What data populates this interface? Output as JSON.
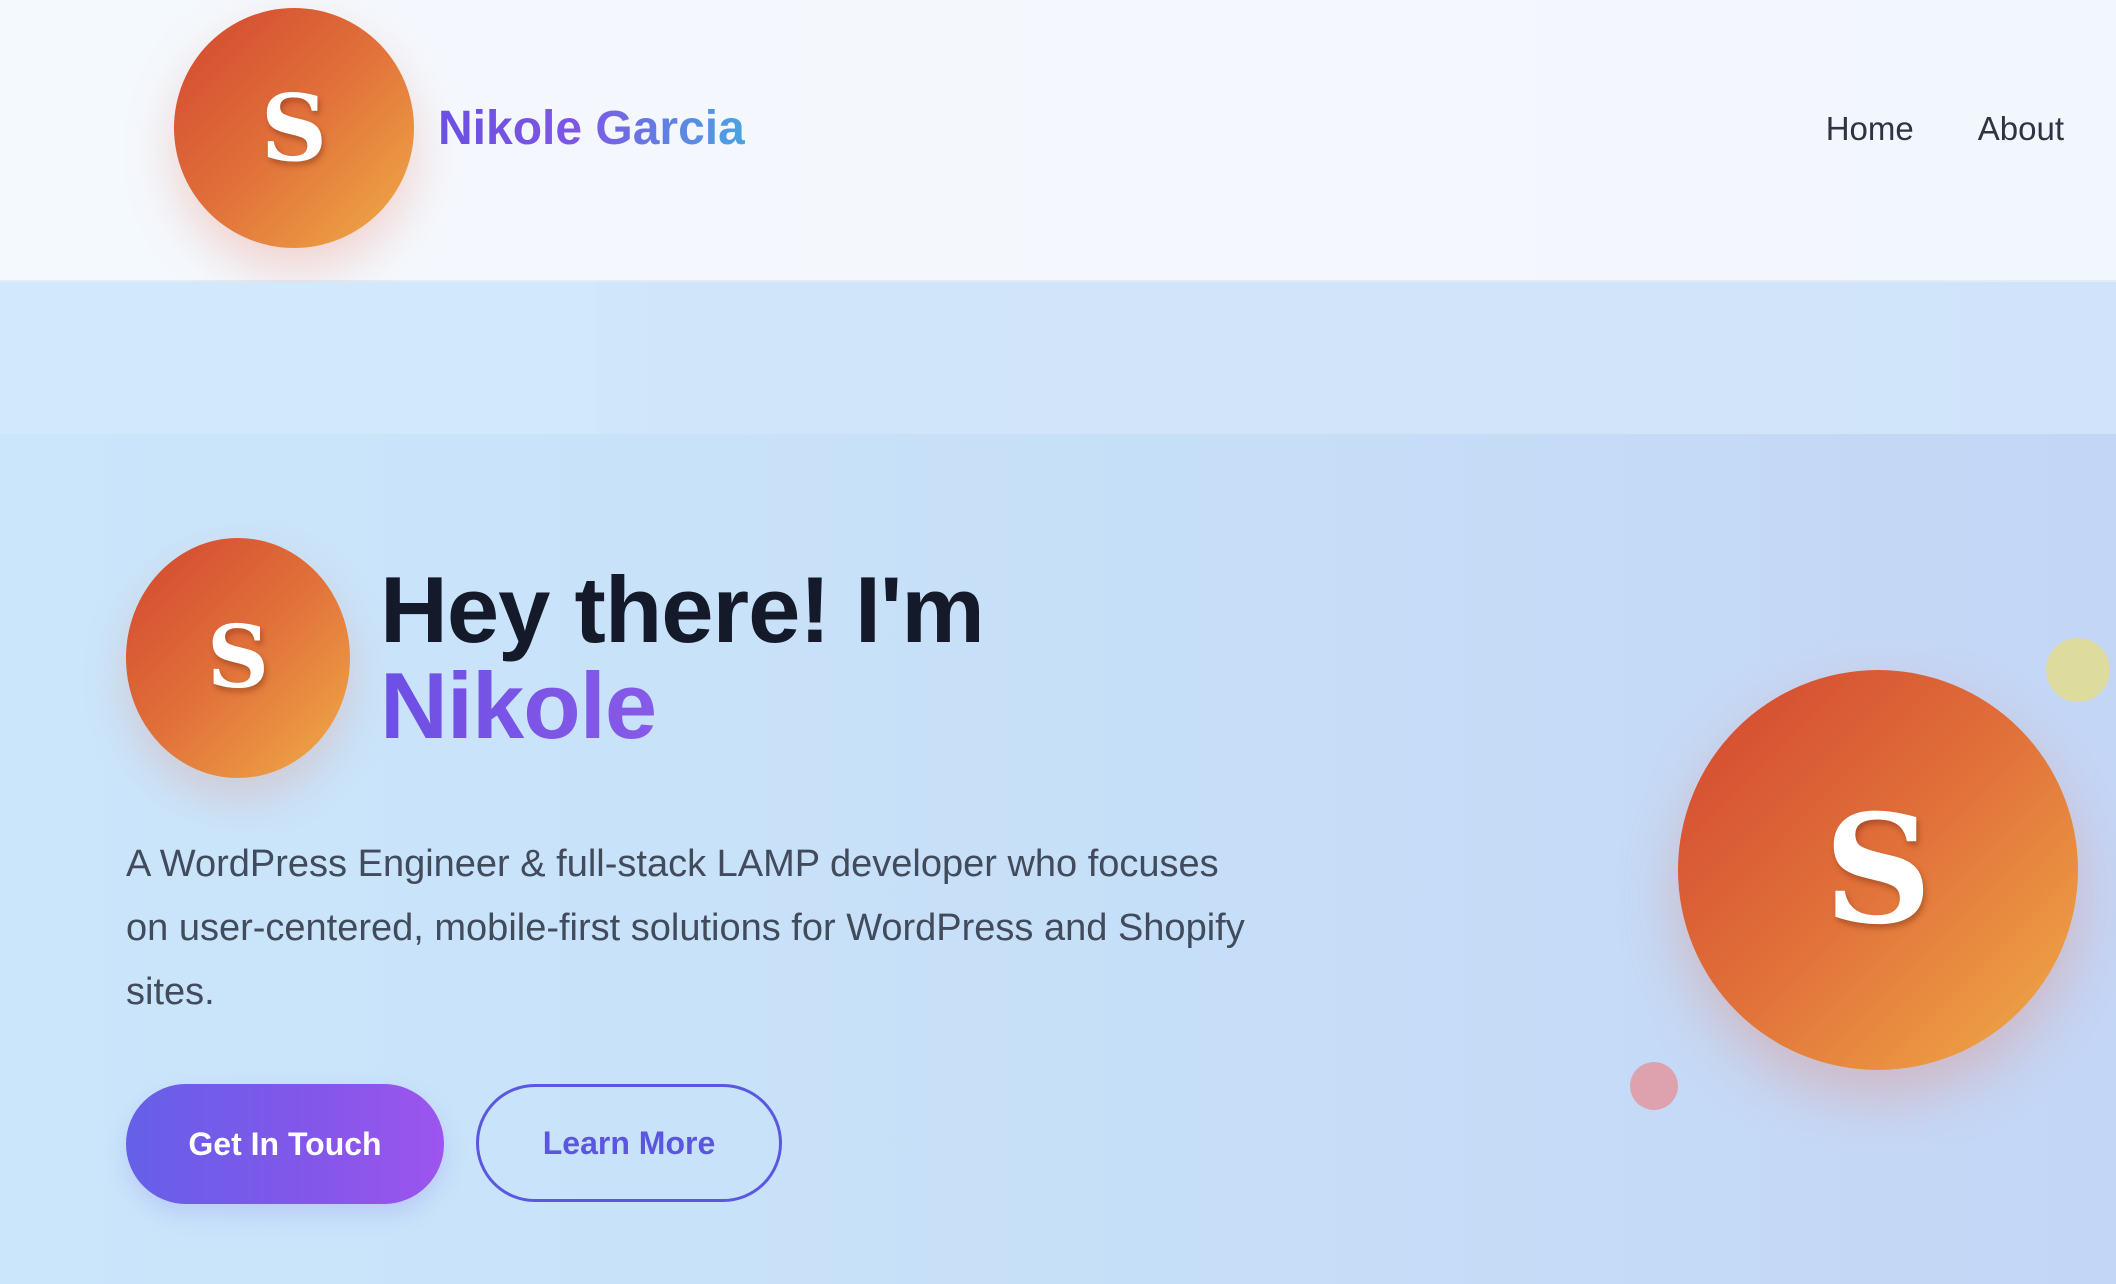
{
  "header": {
    "logo_letter": "S",
    "brand_name": "Nikole Garcia",
    "nav": [
      {
        "label": "Home"
      },
      {
        "label": "About"
      }
    ]
  },
  "hero": {
    "avatar_letter": "S",
    "title_line1": "Hey there! I'm",
    "title_line2": "Nikole",
    "description": "A WordPress Engineer & full-stack LAMP developer who focuses on user-centered, mobile-first solutions for WordPress and Shopify sites.",
    "primary_button": "Get In Touch",
    "secondary_button": "Learn More",
    "side_avatar_letter": "S"
  },
  "colors": {
    "avatar_gradient_start": "#d2452f",
    "avatar_gradient_end": "#f1ad48",
    "brand_gradient_start": "#6b4fe3",
    "brand_gradient_end": "#4aa3e0",
    "primary_button_start": "#6560e8",
    "primary_button_end": "#9d55ee",
    "outline_button": "#5b57e0",
    "heading_text": "#141a2a",
    "body_text": "#414b5c"
  },
  "icons": {
    "logo": "avatar-monogram-icon",
    "decorations": [
      "yellow-dot",
      "pink-dot"
    ]
  }
}
